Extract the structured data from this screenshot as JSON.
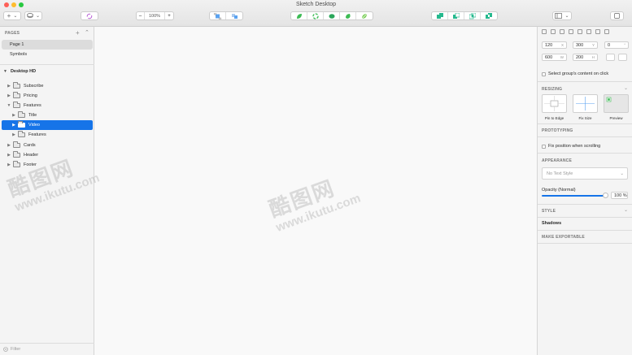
{
  "window": {
    "title": "Sketch Desktop"
  },
  "toolbar": {
    "insert_label": "+",
    "insert_caret": "⌄",
    "group_caret": "⌄",
    "zoom_out": "–",
    "zoom_level": "100%",
    "zoom_in": "+",
    "view_caret": "⌄"
  },
  "sidebar": {
    "pages_header": "PAGES",
    "pages_add": "+",
    "pages_collapse": "⌃",
    "pages": [
      {
        "label": "Page 1",
        "selected": true
      },
      {
        "label": "Symbols",
        "selected": false
      }
    ],
    "artboard": "Desktop HD",
    "layers": [
      {
        "label": "Subscribe",
        "indent": 0,
        "expanded": false
      },
      {
        "label": "Pricing",
        "indent": 0,
        "expanded": false
      },
      {
        "label": "Features",
        "indent": 0,
        "expanded": true
      },
      {
        "label": "Title",
        "indent": 1,
        "expanded": false
      },
      {
        "label": "Video",
        "indent": 1,
        "expanded": false,
        "selected": true
      },
      {
        "label": "Features",
        "indent": 1,
        "expanded": false
      },
      {
        "label": "Cards",
        "indent": 0,
        "expanded": false
      },
      {
        "label": "Header",
        "indent": 0,
        "expanded": false
      },
      {
        "label": "Footer",
        "indent": 0,
        "expanded": false
      }
    ],
    "filter_placeholder": "Filter"
  },
  "watermark": {
    "brand": "酷图网",
    "url": "www.ikutu.com"
  },
  "inspector": {
    "x_value": "120",
    "x_suffix": "X",
    "y_value": "300",
    "y_suffix": "Y",
    "rotation_value": "0",
    "rotation_suffix": "°",
    "w_value": "600",
    "w_suffix": "W",
    "h_value": "200",
    "h_suffix": "H",
    "select_group_label": "Select group's content on click",
    "resizing_header": "RESIZING",
    "pin_to_edge": "Pin to Edge",
    "fix_size": "Fix Size",
    "preview": "Preview",
    "prototyping_header": "PROTOTYPING",
    "fix_position_label": "Fix position when scrolling",
    "appearance_header": "APPEARANCE",
    "text_style_placeholder": "No Text Style",
    "opacity_label": "Opacity (Normal)",
    "opacity_value": "100 %",
    "opacity_fraction": 1.0,
    "style_header": "STYLE",
    "shadows_label": "Shadows",
    "make_exportable": "MAKE EXPORTABLE"
  },
  "colors": {
    "selection": "#1674e8",
    "icon_green": "#3dbb54",
    "close": "#fe5f57",
    "minimize": "#febc2e",
    "zoom": "#28c840",
    "accent_pink": "#b04dd0"
  }
}
